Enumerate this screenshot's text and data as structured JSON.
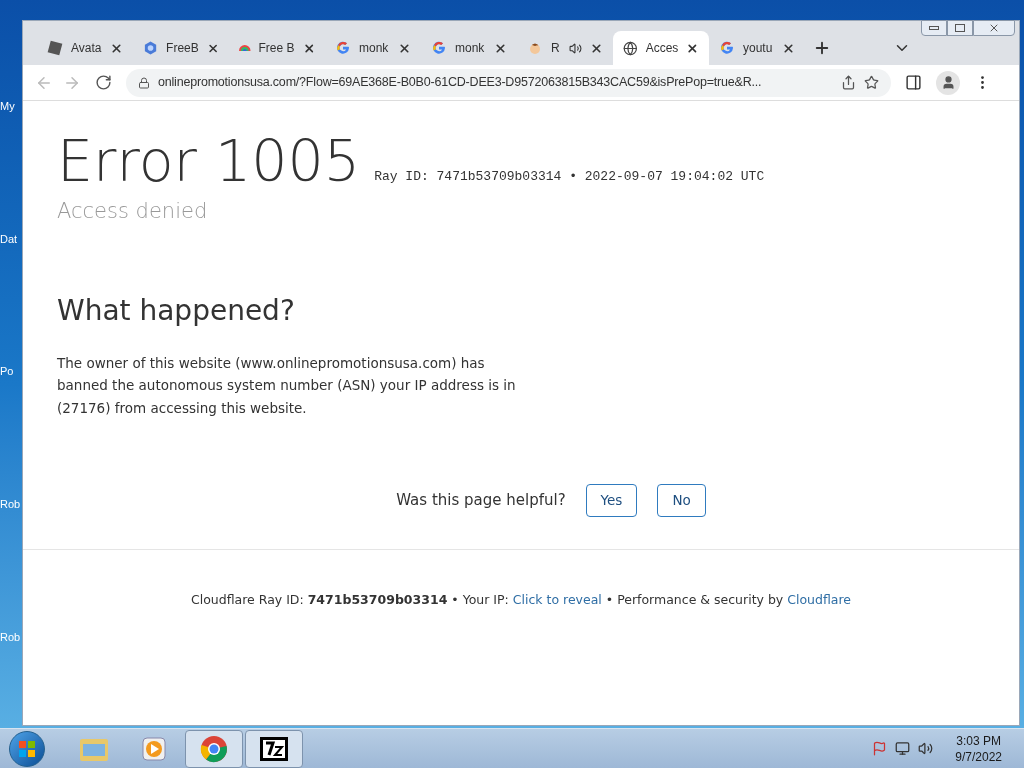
{
  "desktop": {
    "icons": [
      "My",
      "Dat",
      "Po",
      "Rob",
      "Rob"
    ]
  },
  "tabs": [
    {
      "title": "Avata",
      "kind": "cube",
      "selected": false,
      "audio": false
    },
    {
      "title": "FreeB",
      "kind": "hex",
      "selected": false,
      "audio": false
    },
    {
      "title": "Free B",
      "kind": "rainbow",
      "selected": false,
      "audio": false
    },
    {
      "title": "monk",
      "kind": "google",
      "selected": false,
      "audio": false
    },
    {
      "title": "monk",
      "kind": "google",
      "selected": false,
      "audio": false
    },
    {
      "title": "R",
      "kind": "avatar",
      "selected": false,
      "audio": true
    },
    {
      "title": "Acces",
      "kind": "globe",
      "selected": true,
      "audio": false
    },
    {
      "title": "youtu",
      "kind": "google",
      "selected": false,
      "audio": false
    }
  ],
  "address_bar": {
    "url": "onlinepromotionsusa.com/?Flow=69AE368E-B0B0-61CD-DEE3-D9572063815B343CAC59&isPrePop=true&R..."
  },
  "page": {
    "error_title": "Error 1005",
    "ray_line": "Ray ID: 7471b53709b03314 • 2022-09-07 19:04:02 UTC",
    "subtitle": "Access denied",
    "heading": "What happened?",
    "body": "The owner of this website (www.onlinepromotionsusa.com) has banned the autonomous system number (ASN) your IP address is in (27176) from accessing this website.",
    "feedback": {
      "question": "Was this page helpful?",
      "buttons": [
        "Yes",
        "No"
      ]
    },
    "footer": {
      "prefix": "Cloudflare Ray ID: **7471b53709b03314** • Your IP:",
      "reveal_link": "Click to reveal",
      "middle": "• Performance & security by",
      "brand_link": "Cloudflare"
    }
  },
  "taskbar": {
    "apps": [
      {
        "kind": "folder",
        "selected": false
      },
      {
        "kind": "media",
        "selected": false
      },
      {
        "kind": "chrome",
        "selected": true
      },
      {
        "kind": "zip",
        "selected": true
      }
    ],
    "time": "3:03 PM",
    "date": "9/7/2022"
  }
}
